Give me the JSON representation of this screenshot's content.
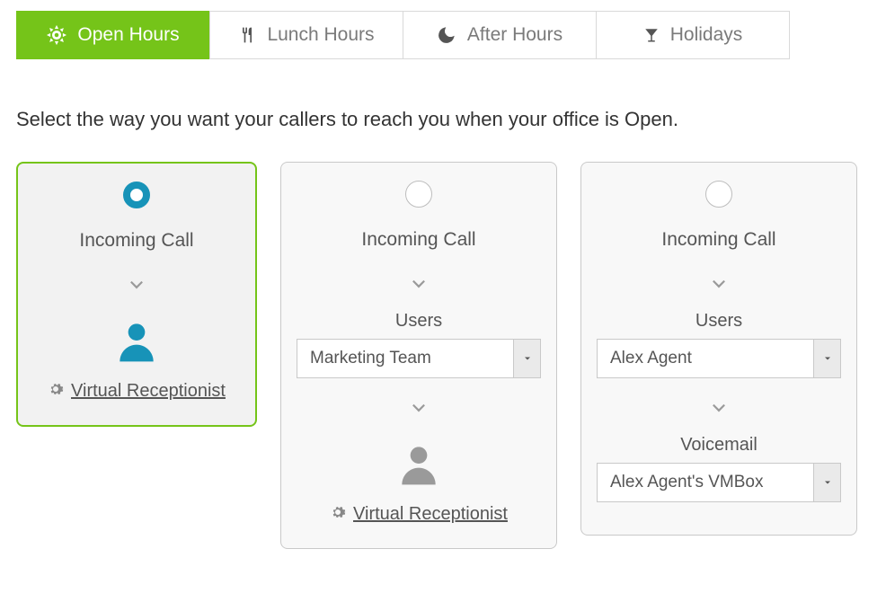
{
  "tabs": [
    {
      "label": "Open Hours"
    },
    {
      "label": "Lunch Hours"
    },
    {
      "label": "After Hours"
    },
    {
      "label": "Holidays"
    }
  ],
  "instruction": "Select the way you want your callers to reach you when your office is Open.",
  "cards": {
    "card1": {
      "title": "Incoming Call",
      "link": "Virtual Receptionist"
    },
    "card2": {
      "title": "Incoming Call",
      "usersLabel": "Users",
      "usersValue": "Marketing Team",
      "link": "Virtual Receptionist"
    },
    "card3": {
      "title": "Incoming Call",
      "usersLabel": "Users",
      "usersValue": "Alex Agent",
      "vmLabel": "Voicemail",
      "vmValue": "Alex Agent's VMBox"
    }
  }
}
